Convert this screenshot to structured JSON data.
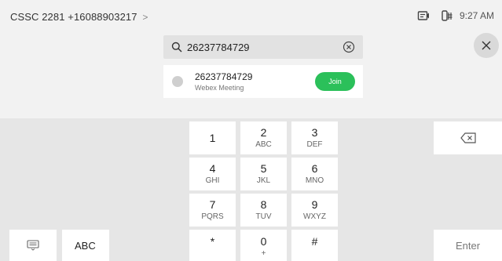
{
  "status_bar": {
    "device_name": "CSSC 2281 +16088903217",
    "chevron": ">",
    "time": "9:27 AM",
    "icons": [
      "screen-share-icon",
      "camera-control-icon"
    ]
  },
  "search": {
    "value": "26237784729",
    "icon": "search-icon",
    "clear_icon": "clear-circle-icon"
  },
  "result": {
    "number": "26237784729",
    "type": "Webex Meeting",
    "join_label": "Join"
  },
  "close_icon": "close-icon",
  "dialpad": {
    "keys": [
      {
        "digit": "1",
        "letters": ""
      },
      {
        "digit": "2",
        "letters": "ABC"
      },
      {
        "digit": "3",
        "letters": "DEF"
      },
      {
        "digit": "4",
        "letters": "GHI"
      },
      {
        "digit": "5",
        "letters": "JKL"
      },
      {
        "digit": "6",
        "letters": "MNO"
      },
      {
        "digit": "7",
        "letters": "PQRS"
      },
      {
        "digit": "8",
        "letters": "TUV"
      },
      {
        "digit": "9",
        "letters": "WXYZ"
      },
      {
        "digit": "*",
        "letters": ""
      },
      {
        "digit": "0",
        "letters": "+"
      },
      {
        "digit": "#",
        "letters": ""
      }
    ],
    "abc_label": "ABC",
    "enter_label": "Enter",
    "backspace_icon": "backspace-icon",
    "keyboard_icon": "keyboard-icon"
  },
  "colors": {
    "join_green": "#2bc05a",
    "background": "#f2f2f2",
    "keyboard_bg": "#e6e6e6"
  }
}
